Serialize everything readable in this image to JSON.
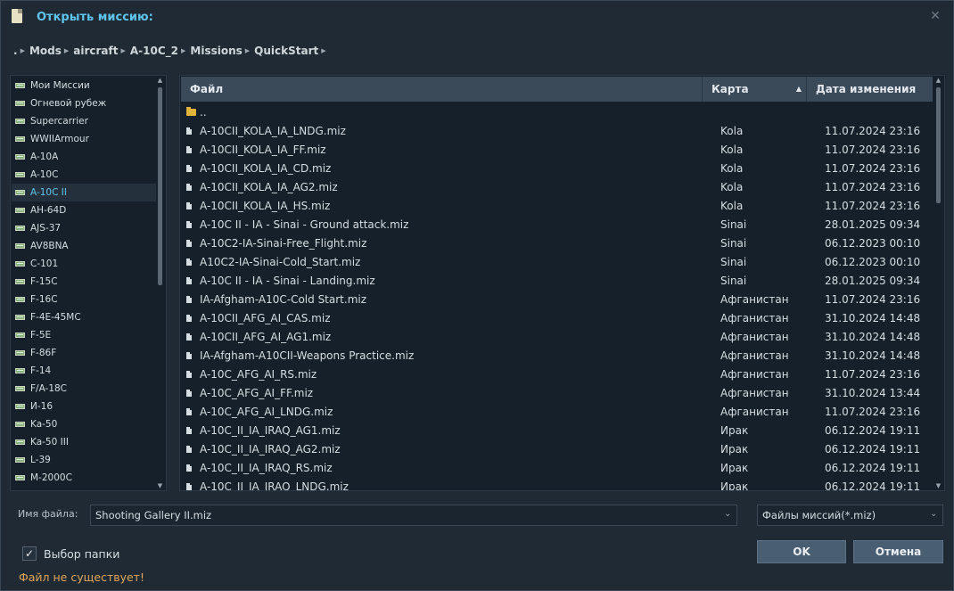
{
  "title": "Открыть миссию:",
  "breadcrumb": [
    ".",
    "Mods",
    "aircraft",
    "A-10C_2",
    "Missions",
    "QuickStart"
  ],
  "left_items": [
    {
      "label": "Мои Миссии"
    },
    {
      "label": "Огневой рубеж"
    },
    {
      "label": "Supercarrier"
    },
    {
      "label": "WWIIArmour"
    },
    {
      "label": "A-10A"
    },
    {
      "label": "A-10C"
    },
    {
      "label": "A-10C II",
      "selected": true
    },
    {
      "label": "AH-64D"
    },
    {
      "label": "AJS-37"
    },
    {
      "label": "AV8BNA"
    },
    {
      "label": "C-101"
    },
    {
      "label": "F-15C"
    },
    {
      "label": "F-16C"
    },
    {
      "label": "F-4E-45MC"
    },
    {
      "label": "F-5E"
    },
    {
      "label": "F-86F"
    },
    {
      "label": "F-14"
    },
    {
      "label": "F/A-18C"
    },
    {
      "label": "И-16"
    },
    {
      "label": "Ka-50"
    },
    {
      "label": "Ka-50 III"
    },
    {
      "label": "L-39"
    },
    {
      "label": "M-2000C"
    }
  ],
  "table": {
    "columns": {
      "file": "Файл",
      "map": "Карта",
      "date": "Дата изменения"
    },
    "parent_label": "..",
    "rows": [
      {
        "file": "A-10CII_KOLA_IA_LNDG.miz",
        "map": "Kola",
        "date": "11.07.2024 23:16"
      },
      {
        "file": "A-10CII_KOLA_IA_FF.miz",
        "map": "Kola",
        "date": "11.07.2024 23:16"
      },
      {
        "file": "A-10CII_KOLA_IA_CD.miz",
        "map": "Kola",
        "date": "11.07.2024 23:16"
      },
      {
        "file": "A-10CII_KOLA_IA_AG2.miz",
        "map": "Kola",
        "date": "11.07.2024 23:16"
      },
      {
        "file": "A-10CII_KOLA_IA_HS.miz",
        "map": "Kola",
        "date": "11.07.2024 23:16"
      },
      {
        "file": "A-10C II - IA - Sinai - Ground attack.miz",
        "map": "Sinai",
        "date": "28.01.2025 09:34"
      },
      {
        "file": "A-10C2-IA-Sinai-Free_Flight.miz",
        "map": "Sinai",
        "date": "06.12.2023 00:10"
      },
      {
        "file": "A10C2-IA-Sinai-Cold_Start.miz",
        "map": "Sinai",
        "date": "06.12.2023 00:10"
      },
      {
        "file": "A-10C II - IA - Sinai - Landing.miz",
        "map": "Sinai",
        "date": "28.01.2025 09:34"
      },
      {
        "file": "IA-Afgham-A10C-Cold Start.miz",
        "map": "Афганистан",
        "date": "11.07.2024 23:16"
      },
      {
        "file": "A-10CII_AFG_AI_CAS.miz",
        "map": "Афганистан",
        "date": "31.10.2024 14:48"
      },
      {
        "file": "A-10CII_AFG_AI_AG1.miz",
        "map": "Афганистан",
        "date": "31.10.2024 14:48"
      },
      {
        "file": "IA-Afgham-A10CII-Weapons Practice.miz",
        "map": "Афганистан",
        "date": "31.10.2024 14:48"
      },
      {
        "file": "A-10C_AFG_AI_RS.miz",
        "map": "Афганистан",
        "date": "11.07.2024 23:16"
      },
      {
        "file": "A-10C_AFG_AI_FF.miz",
        "map": "Афганистан",
        "date": "31.10.2024 13:44"
      },
      {
        "file": "A-10C_AFG_AI_LNDG.miz",
        "map": "Афганистан",
        "date": "11.07.2024 23:16"
      },
      {
        "file": "A-10C_II_IA_IRAQ_AG1.miz",
        "map": "Ирак",
        "date": "06.12.2024 19:11"
      },
      {
        "file": "A-10C_II_IA_IRAQ_AG2.miz",
        "map": "Ирак",
        "date": "06.12.2024 19:11"
      },
      {
        "file": "A-10C_II_IA_IRAQ_RS.miz",
        "map": "Ирак",
        "date": "06.12.2024 19:11"
      },
      {
        "file": "A-10C_II_IA_IRAQ_LNDG.miz",
        "map": "Ирак",
        "date": "06.12.2024 19:11"
      }
    ]
  },
  "filename": {
    "label": "Имя файла:",
    "value": "Shooting Gallery II.miz"
  },
  "filter": {
    "value": "Файлы миссий(*.miz)"
  },
  "checkbox": {
    "label": "Выбор папки",
    "checked": true
  },
  "error": "Файл не существует!",
  "buttons": {
    "ok": "OK",
    "cancel": "Отмена"
  },
  "icons": {
    "close": "close-icon",
    "folder": "folder-icon",
    "file": "file-icon",
    "aircraft": "aircraft-icon"
  },
  "colors": {
    "accent": "#5fc4ec",
    "warning": "#e0a55a",
    "background": "#1f2a34",
    "panel": "#15202a",
    "header": "#3a4a59"
  }
}
